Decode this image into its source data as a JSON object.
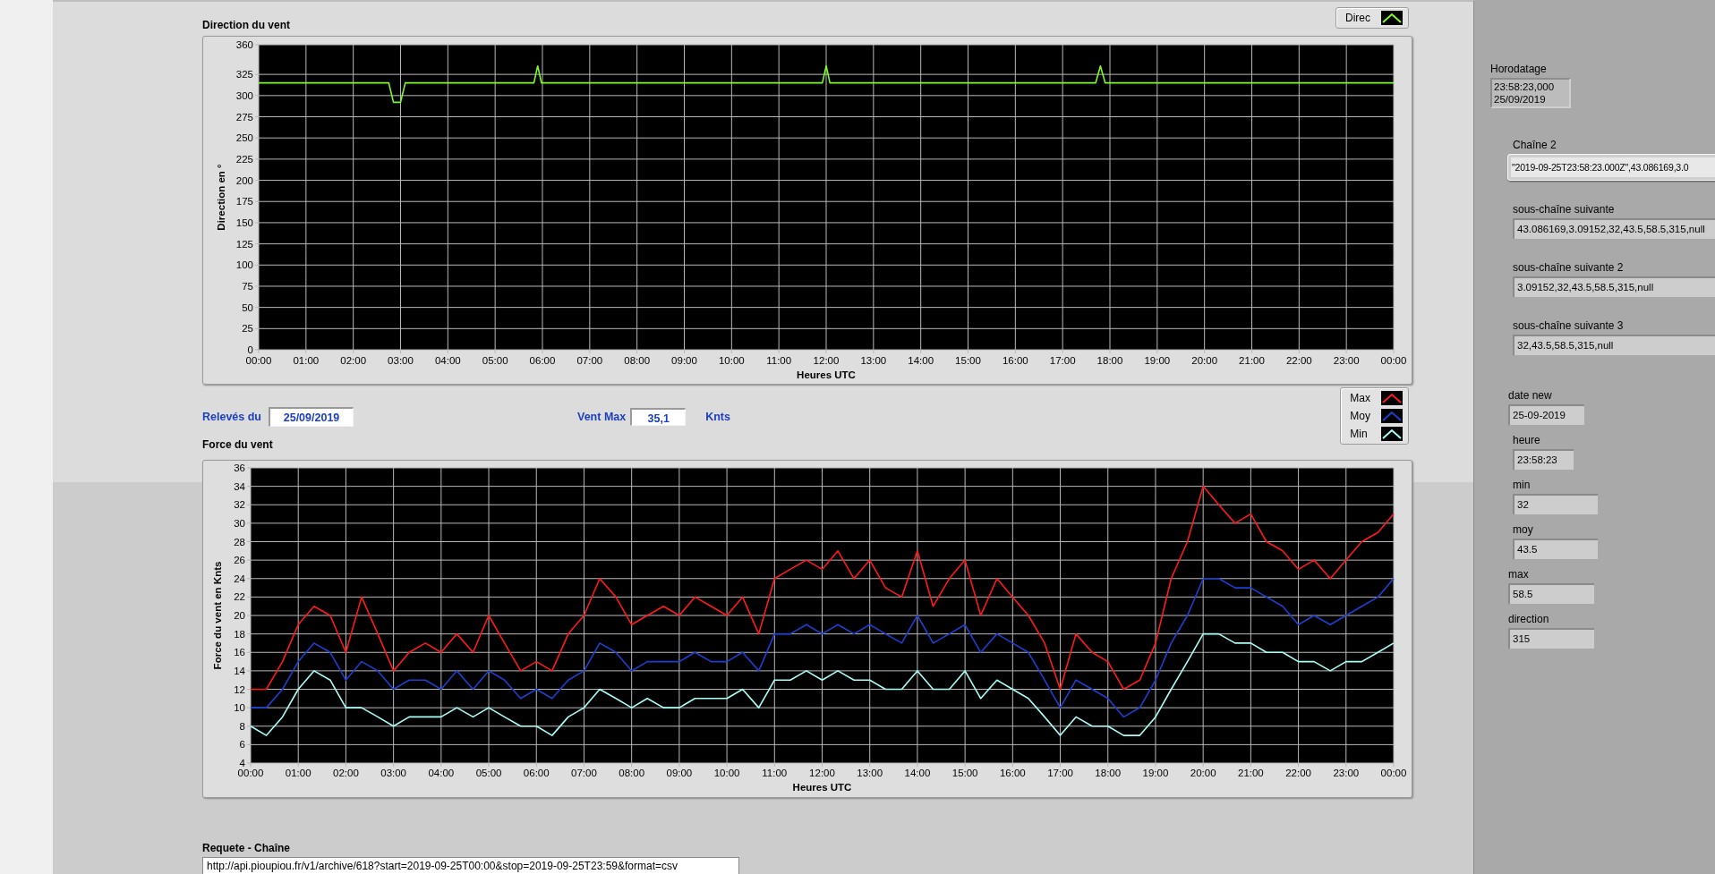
{
  "direction_chart": {
    "title": "Direction du vent",
    "chart_data": {
      "type": "line",
      "grid": true,
      "xlabel": "Heures UTC",
      "ylabel": "Direction en °",
      "xlim": [
        0,
        24
      ],
      "ylim": [
        0,
        360
      ],
      "yticks": [
        0,
        25,
        50,
        75,
        100,
        125,
        150,
        175,
        200,
        225,
        250,
        275,
        300,
        325,
        360
      ],
      "xticks": [
        {
          "value": 0,
          "label": "00:00"
        },
        {
          "value": 1,
          "label": "01:00"
        },
        {
          "value": 2,
          "label": "02:00"
        },
        {
          "value": 3,
          "label": "03:00"
        },
        {
          "value": 4,
          "label": "04:00"
        },
        {
          "value": 5,
          "label": "05:00"
        },
        {
          "value": 6,
          "label": "06:00"
        },
        {
          "value": 7,
          "label": "07:00"
        },
        {
          "value": 8,
          "label": "08:00"
        },
        {
          "value": 9,
          "label": "09:00"
        },
        {
          "value": 10,
          "label": "10:00"
        },
        {
          "value": 11,
          "label": "11:00"
        },
        {
          "value": 12,
          "label": "12:00"
        },
        {
          "value": 13,
          "label": "13:00"
        },
        {
          "value": 14,
          "label": "14:00"
        },
        {
          "value": 15,
          "label": "15:00"
        },
        {
          "value": 16,
          "label": "16:00"
        },
        {
          "value": 17,
          "label": "17:00"
        },
        {
          "value": 18,
          "label": "18:00"
        },
        {
          "value": 19,
          "label": "19:00"
        },
        {
          "value": 20,
          "label": "20:00"
        },
        {
          "value": 21,
          "label": "21:00"
        },
        {
          "value": 22,
          "label": "22:00"
        },
        {
          "value": 23,
          "label": "23:00"
        },
        {
          "value": 24,
          "label": "00:00"
        }
      ],
      "x": [
        0,
        2.75,
        2.85,
        3.0,
        3.1,
        5.82,
        5.9,
        5.98,
        11.92,
        12.0,
        12.08,
        17.7,
        17.8,
        17.9,
        24
      ],
      "series": [
        {
          "name": "Direc",
          "color": "#7cfc2a",
          "values": [
            315,
            315,
            292,
            292,
            315,
            315,
            335,
            315,
            315,
            335,
            315,
            315,
            335,
            315,
            315
          ]
        }
      ]
    }
  },
  "readings": {
    "date_label": "Relevés du",
    "date": "25/09/2019",
    "max_label": "Vent Max",
    "max_value": "35,1",
    "max_unit": "Knts"
  },
  "force_chart": {
    "title": "Force du vent",
    "chart_data": {
      "type": "line",
      "grid": true,
      "xlabel": "Heures UTC",
      "ylabel": "Force du vent en Knts",
      "xlim": [
        0,
        24
      ],
      "ylim": [
        4,
        36
      ],
      "yticks": [
        4,
        6,
        8,
        10,
        12,
        14,
        16,
        18,
        20,
        22,
        24,
        26,
        28,
        30,
        32,
        34,
        36
      ],
      "xticks": [
        {
          "value": 0,
          "label": "00:00"
        },
        {
          "value": 1,
          "label": "01:00"
        },
        {
          "value": 2,
          "label": "02:00"
        },
        {
          "value": 3,
          "label": "03:00"
        },
        {
          "value": 4,
          "label": "04:00"
        },
        {
          "value": 5,
          "label": "05:00"
        },
        {
          "value": 6,
          "label": "06:00"
        },
        {
          "value": 7,
          "label": "07:00"
        },
        {
          "value": 8,
          "label": "08:00"
        },
        {
          "value": 9,
          "label": "09:00"
        },
        {
          "value": 10,
          "label": "10:00"
        },
        {
          "value": 11,
          "label": "11:00"
        },
        {
          "value": 12,
          "label": "12:00"
        },
        {
          "value": 13,
          "label": "13:00"
        },
        {
          "value": 14,
          "label": "14:00"
        },
        {
          "value": 15,
          "label": "15:00"
        },
        {
          "value": 16,
          "label": "16:00"
        },
        {
          "value": 17,
          "label": "17:00"
        },
        {
          "value": 18,
          "label": "18:00"
        },
        {
          "value": 19,
          "label": "19:00"
        },
        {
          "value": 20,
          "label": "20:00"
        },
        {
          "value": 21,
          "label": "21:00"
        },
        {
          "value": 22,
          "label": "22:00"
        },
        {
          "value": 23,
          "label": "23:00"
        },
        {
          "value": 24,
          "label": "00:00"
        }
      ],
      "x": [
        0,
        0.33,
        0.67,
        1,
        1.33,
        1.67,
        2,
        2.33,
        2.67,
        3,
        3.33,
        3.67,
        4,
        4.33,
        4.67,
        5,
        5.33,
        5.67,
        6,
        6.33,
        6.67,
        7,
        7.33,
        7.67,
        8,
        8.33,
        8.67,
        9,
        9.33,
        9.67,
        10,
        10.33,
        10.67,
        11,
        11.33,
        11.67,
        12,
        12.33,
        12.67,
        13,
        13.33,
        13.67,
        14,
        14.33,
        14.67,
        15,
        15.33,
        15.67,
        16,
        16.33,
        16.67,
        17,
        17.33,
        17.67,
        18,
        18.33,
        18.67,
        19,
        19.33,
        19.67,
        20,
        20.33,
        20.67,
        21,
        21.33,
        21.67,
        22,
        22.33,
        22.67,
        23,
        23.33,
        23.67,
        24
      ],
      "series": [
        {
          "name": "Max",
          "color": "#ff1a1a",
          "values": [
            12,
            12,
            15,
            19,
            21,
            20,
            16,
            22,
            18,
            14,
            16,
            17,
            16,
            18,
            16,
            20,
            17,
            14,
            15,
            14,
            18,
            20,
            24,
            22,
            19,
            20,
            21,
            20,
            22,
            21,
            20,
            22,
            18,
            24,
            25,
            26,
            25,
            27,
            24,
            26,
            23,
            22,
            27,
            21,
            24,
            26,
            20,
            24,
            22,
            20,
            17,
            12,
            18,
            16,
            15,
            12,
            13,
            17,
            24,
            28,
            34,
            32,
            30,
            31,
            28,
            27,
            25,
            26,
            24,
            26,
            28,
            29,
            31
          ]
        },
        {
          "name": "Moy",
          "color": "#1e3fd0",
          "values": [
            10,
            10,
            12,
            15,
            17,
            16,
            13,
            15,
            14,
            12,
            13,
            13,
            12,
            14,
            12,
            14,
            13,
            11,
            12,
            11,
            13,
            14,
            17,
            16,
            14,
            15,
            15,
            15,
            16,
            15,
            15,
            16,
            14,
            18,
            18,
            19,
            18,
            19,
            18,
            19,
            18,
            17,
            20,
            17,
            18,
            19,
            16,
            18,
            17,
            16,
            13,
            10,
            13,
            12,
            11,
            9,
            10,
            13,
            17,
            20,
            24,
            24,
            23,
            23,
            22,
            21,
            19,
            20,
            19,
            20,
            21,
            22,
            24
          ]
        },
        {
          "name": "Min",
          "color": "#a8fff8",
          "values": [
            8,
            7,
            9,
            12,
            14,
            13,
            10,
            10,
            9,
            8,
            9,
            9,
            9,
            10,
            9,
            10,
            9,
            8,
            8,
            7,
            9,
            10,
            12,
            11,
            10,
            11,
            10,
            10,
            11,
            11,
            11,
            12,
            10,
            13,
            13,
            14,
            13,
            14,
            13,
            13,
            12,
            12,
            14,
            12,
            12,
            14,
            11,
            13,
            12,
            11,
            9,
            7,
            9,
            8,
            8,
            7,
            7,
            9,
            12,
            15,
            18,
            18,
            17,
            17,
            16,
            16,
            15,
            15,
            14,
            15,
            15,
            16,
            17
          ]
        }
      ]
    }
  },
  "request": {
    "label": "Requete - Chaîne",
    "value": "http://api.pioupiou.fr/v1/archive/618?start=2019-09-25T00:00&stop=2019-09-25T23:59&format=csv"
  },
  "side_panel": {
    "timestamp": {
      "label": "Horodatage",
      "lines": [
        "23:58:23,000",
        "25/09/2019"
      ]
    },
    "strings": [
      {
        "label": "Chaîne 2",
        "value": "\"2019-09-25T23:58:23.000Z\",43.086169,3.0"
      },
      {
        "label": "sous-chaîne suivante",
        "value": "43.086169,3.09152,32,43.5,58.5,315,null"
      },
      {
        "label": "sous-chaîne suivante 2",
        "value": "3.09152,32,43.5,58.5,315,null"
      },
      {
        "label": "sous-chaîne suivante 3",
        "value": "32,43.5,58.5,315,null"
      }
    ],
    "values": [
      {
        "label": "date new",
        "value": "25-09-2019"
      },
      {
        "label": "heure",
        "value": "23:58:23"
      },
      {
        "label": "min",
        "value": "32"
      },
      {
        "label": "moy",
        "value": "43.5"
      },
      {
        "label": "max",
        "value": "58.5"
      },
      {
        "label": "direction",
        "value": "315"
      }
    ]
  }
}
